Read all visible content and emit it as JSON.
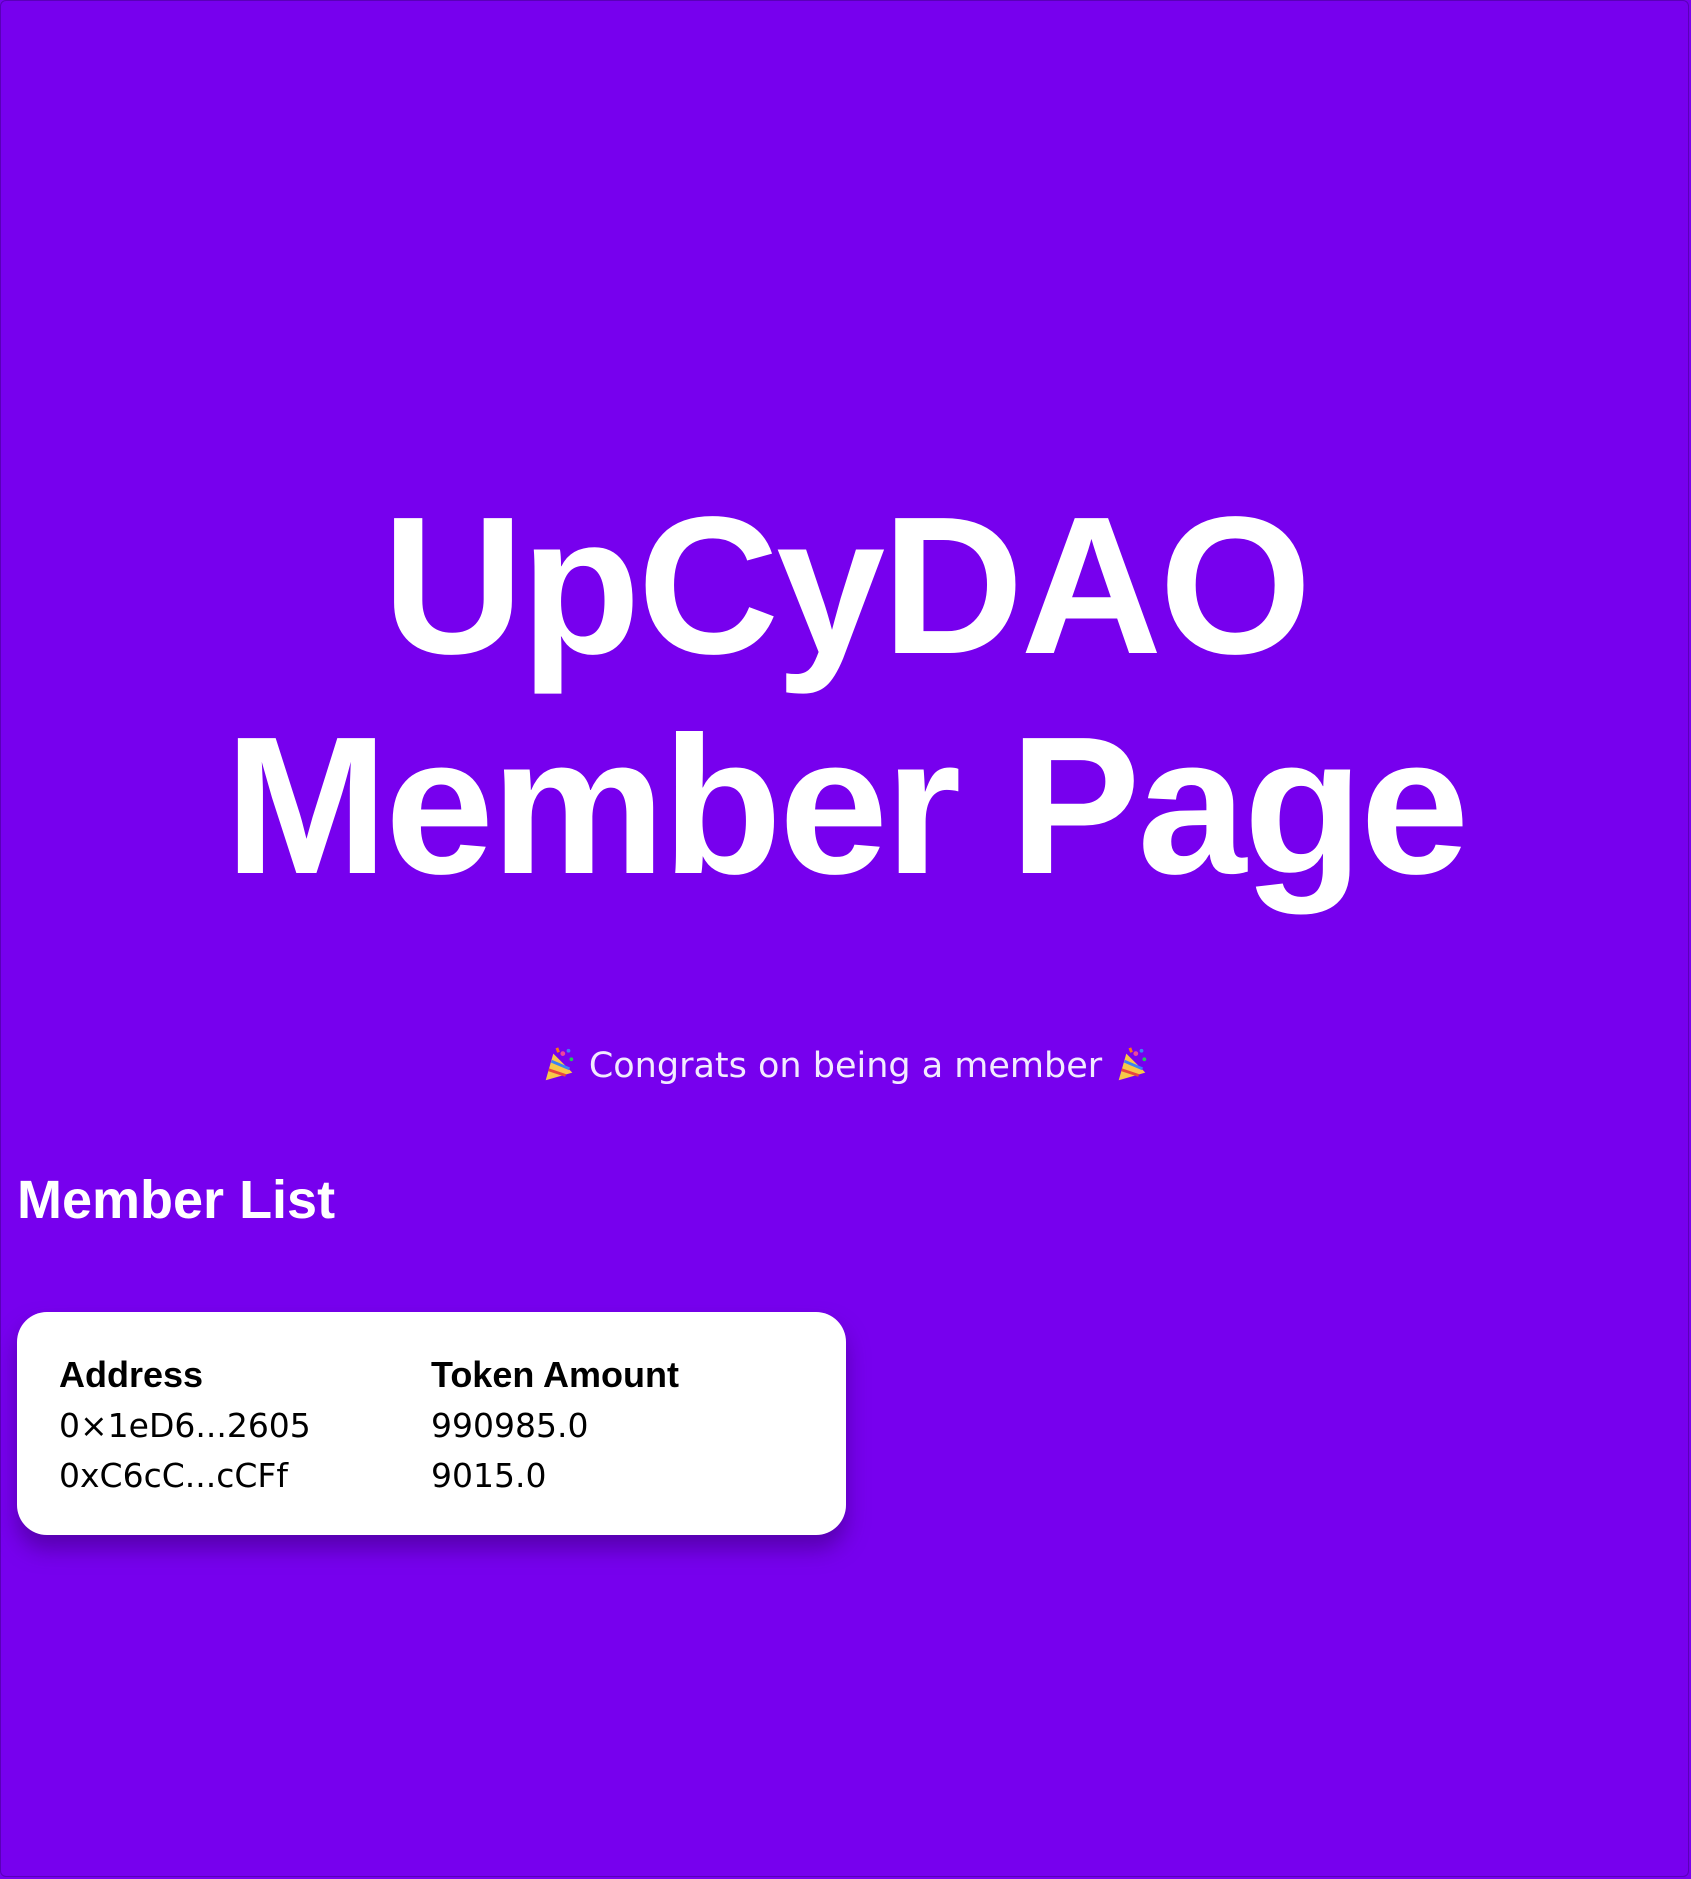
{
  "header": {
    "title": "UpCyDAO Member Page",
    "congrats": "Congrats on being a member",
    "congrats_icon": "party-popper-icon"
  },
  "member_list": {
    "heading": "Member List",
    "columns": [
      "Address",
      "Token Amount"
    ],
    "rows": [
      {
        "address": "0×1eD6...2605",
        "token_amount": "990985.0"
      },
      {
        "address": "0xC6cC...cCFf",
        "token_amount": "9015.0"
      }
    ]
  },
  "colors": {
    "background": "#7700ee",
    "text": "#ffffff",
    "card": "#ffffff"
  }
}
